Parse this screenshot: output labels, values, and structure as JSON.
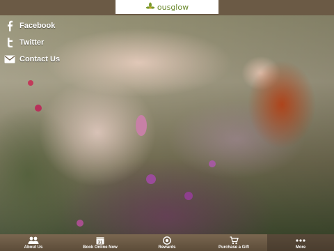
{
  "header": {
    "logo_text": "ousglow"
  },
  "social": {
    "items": [
      {
        "label": "Facebook",
        "icon": "facebook-icon"
      },
      {
        "label": "Twitter",
        "icon": "twitter-icon"
      },
      {
        "label": "Contact Us",
        "icon": "envelope-icon"
      }
    ]
  },
  "tabs": {
    "items": [
      {
        "label": "About Us",
        "icon": "people-icon"
      },
      {
        "label": "Book Online Now",
        "icon": "calendar-icon",
        "icon_text": "31"
      },
      {
        "label": "Rewards",
        "icon": "rewards-icon"
      },
      {
        "label": "Purchase a Gift",
        "icon": "cart-icon"
      },
      {
        "label": "More",
        "icon": "more-icon"
      }
    ],
    "active_label": "More"
  },
  "colors": {
    "bar": "#6b5a45",
    "logo_green": "#6b8a2d",
    "text": "#ffffff"
  }
}
